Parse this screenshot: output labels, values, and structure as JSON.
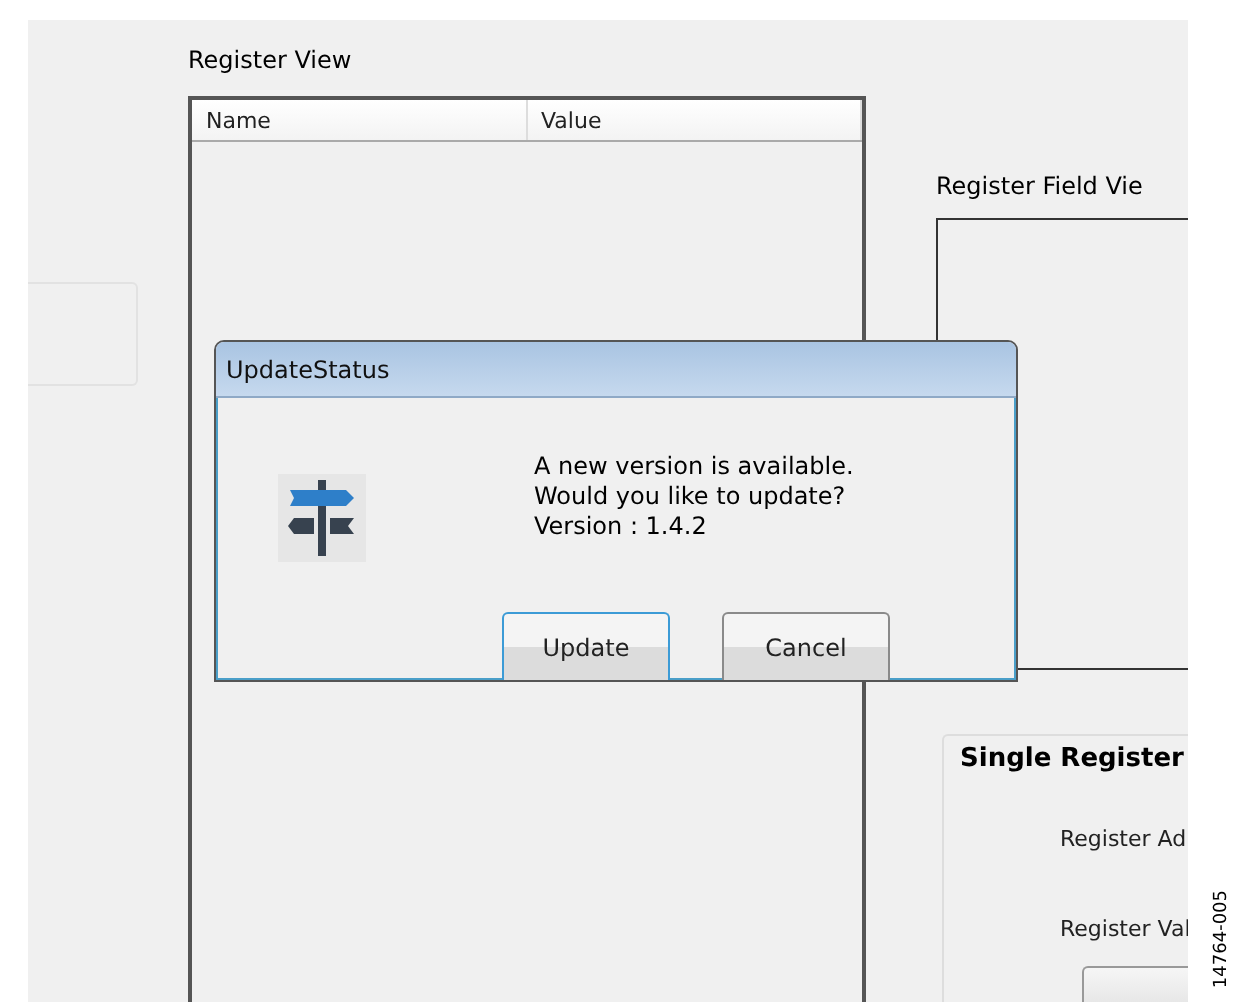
{
  "register_view": {
    "title": "Register View",
    "columns": [
      "Name",
      "Value"
    ]
  },
  "register_field_view": {
    "title": "Register Field Vie"
  },
  "single_register": {
    "title": "Single Register",
    "labels": [
      "Register Ad",
      "Register Val"
    ]
  },
  "dialog": {
    "title": "UpdateStatus",
    "message": [
      "A new version is available.",
      "Would you like to update?",
      "Version : 1.4.2"
    ],
    "buttons": [
      {
        "label": "Update",
        "selected": true
      },
      {
        "label": "Cancel",
        "selected": false
      }
    ]
  },
  "figure_number": "14764-005"
}
